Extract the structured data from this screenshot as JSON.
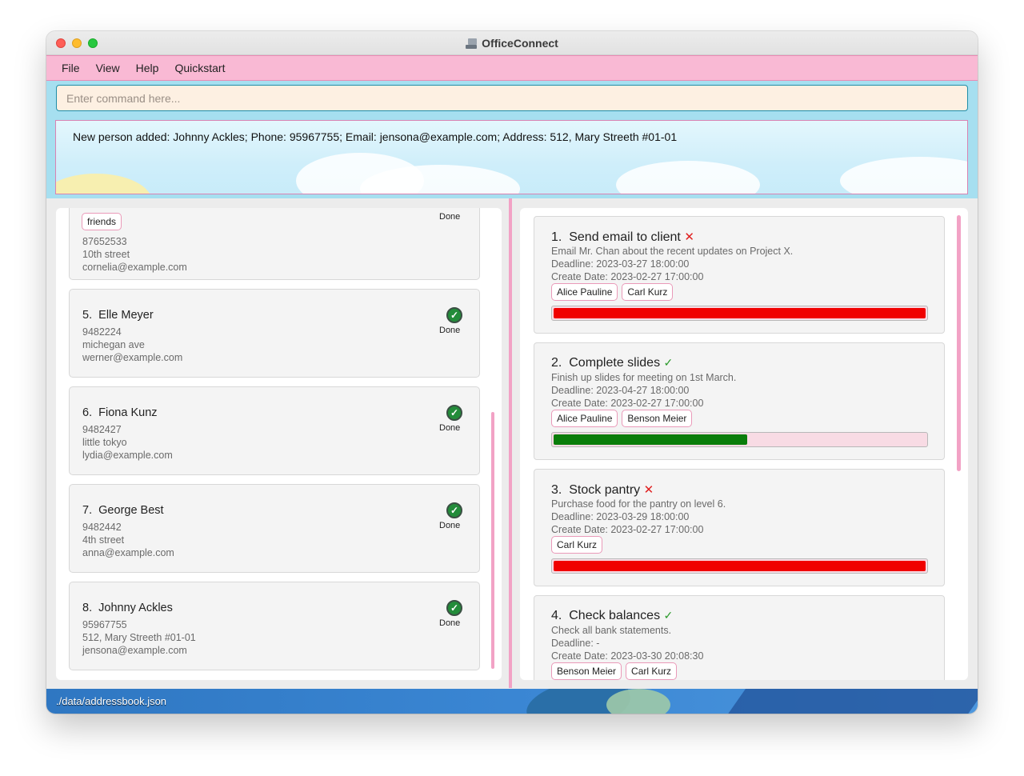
{
  "window": {
    "title": "OfficeConnect"
  },
  "menu": [
    "File",
    "View",
    "Help",
    "Quickstart"
  ],
  "command": {
    "placeholder": "Enter command here...",
    "value": ""
  },
  "result": {
    "message": "New person added: Johnny Ackles; Phone: 95967755; Email: jensona@example.com; Address: 512, Mary Streeth #01-01"
  },
  "persons": [
    {
      "index": "",
      "name": "",
      "tag": "friends",
      "phone": "87652533",
      "address": "10th street",
      "email": "cornelia@example.com",
      "status": "Done"
    },
    {
      "index": "5.",
      "name": "Elle Meyer",
      "phone": "9482224",
      "address": "michegan ave",
      "email": "werner@example.com",
      "status": "Done"
    },
    {
      "index": "6.",
      "name": "Fiona Kunz",
      "phone": "9482427",
      "address": "little tokyo",
      "email": "lydia@example.com",
      "status": "Done"
    },
    {
      "index": "7.",
      "name": "George Best",
      "phone": "9482442",
      "address": "4th street",
      "email": "anna@example.com",
      "status": "Done"
    },
    {
      "index": "8.",
      "name": "Johnny Ackles",
      "phone": "95967755",
      "address": "512, Mary Streeth #01-01",
      "email": "jensona@example.com",
      "status": "Done"
    }
  ],
  "tasks": [
    {
      "index": "1.",
      "title": "Send email to client",
      "mark": "✕",
      "done": false,
      "description": "Email Mr. Chan about the recent updates on Project X.",
      "deadline": "Deadline: 2023-03-27 18:00:00",
      "created": "Create Date: 2023-02-27 17:00:00",
      "assignees": [
        "Alice Pauline",
        "Carl Kurz"
      ],
      "progress": 1.0,
      "bar_color": "#f00000"
    },
    {
      "index": "2.",
      "title": "Complete slides",
      "mark": "✓",
      "done": true,
      "description": "Finish up slides for meeting on 1st March.",
      "deadline": "Deadline: 2023-04-27 18:00:00",
      "created": "Create Date: 2023-02-27 17:00:00",
      "assignees": [
        "Alice Pauline",
        "Benson Meier"
      ],
      "progress": 0.52,
      "bar_color": "#0a7d0a"
    },
    {
      "index": "3.",
      "title": "Stock pantry",
      "mark": "✕",
      "done": false,
      "description": "Purchase food for the pantry on level 6.",
      "deadline": "Deadline: 2023-03-29 18:00:00",
      "created": "Create Date: 2023-02-27 17:00:00",
      "assignees": [
        "Carl Kurz"
      ],
      "progress": 1.0,
      "bar_color": "#f00000"
    },
    {
      "index": "4.",
      "title": "Check balances",
      "mark": "✓",
      "done": true,
      "description": "Check all bank statements.",
      "deadline": "Deadline: -",
      "created": "Create Date: 2023-03-30 20:08:30",
      "assignees": [
        "Benson Meier",
        "Carl Kurz"
      ]
    }
  ],
  "status": {
    "path": "./data/addressbook.json"
  },
  "colors": {
    "menu_bg": "#f9b9d4",
    "command_bg": "#a6dff0",
    "accent_pink": "#f2a2c5",
    "done_green": "#238c3a",
    "overdue_red": "#f00000"
  },
  "icons": {
    "done": "check-circle-icon",
    "overdue": "cross-icon",
    "complete": "checkmark-icon"
  }
}
